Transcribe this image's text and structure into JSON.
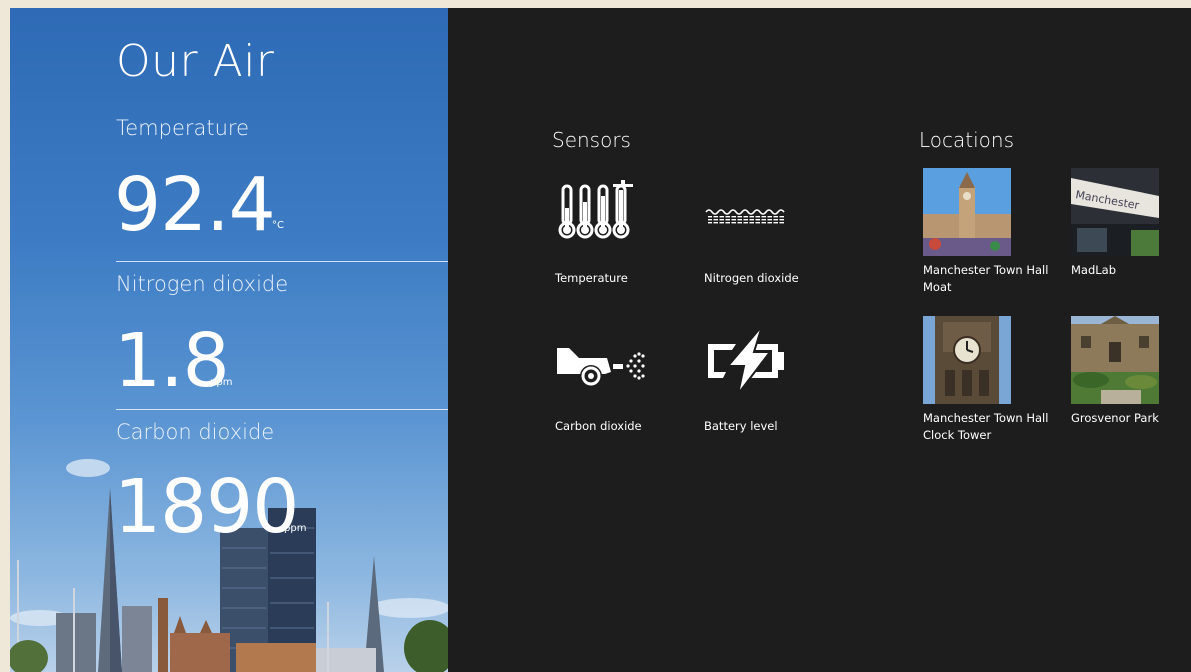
{
  "app": {
    "title": "Our Air"
  },
  "metrics": [
    {
      "label": "Temperature",
      "value": "92.4",
      "unit": "°C"
    },
    {
      "label": "Nitrogen dioxide",
      "value": "1.8",
      "unit": "ppm"
    },
    {
      "label": "Carbon dioxide",
      "value": "1890",
      "unit": "ppm"
    }
  ],
  "sensors": {
    "title": "Sensors",
    "items": [
      {
        "label": "Temperature",
        "icon": "thermometers-icon"
      },
      {
        "label": "Nitrogen dioxide",
        "icon": "nitrogen-dioxide-icon"
      },
      {
        "label": "Carbon dioxide",
        "icon": "car-exhaust-icon"
      },
      {
        "label": "Battery level",
        "icon": "battery-icon"
      }
    ]
  },
  "locations": {
    "title": "Locations",
    "items": [
      {
        "line1": "Manchester Town Hall",
        "line2": "Moat",
        "icon": "town-hall-photo"
      },
      {
        "line1": "MadLab",
        "line2": "",
        "icon": "madlab-photo"
      },
      {
        "line1": "Manchester Town Hall",
        "line2": "Clock Tower",
        "icon": "clock-tower-photo"
      },
      {
        "line1": "Grosvenor Park",
        "line2": "",
        "icon": "grosvenor-park-photo"
      }
    ]
  },
  "colors": {
    "panel_bg": "#1d1d1d",
    "sky": "#3d7cc4",
    "text": "#ffffff"
  }
}
